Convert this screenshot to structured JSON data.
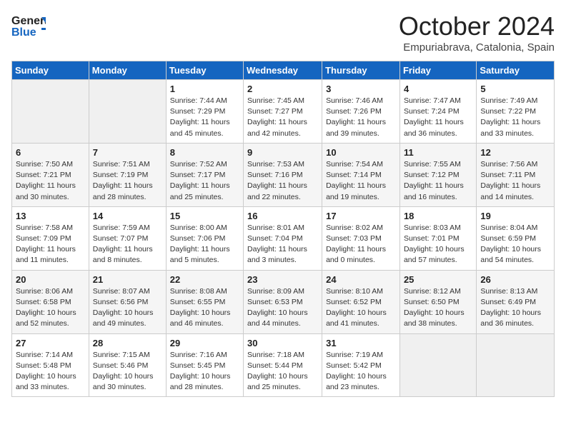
{
  "header": {
    "logo_general": "General",
    "logo_blue": "Blue",
    "month_title": "October 2024",
    "location": "Empuriabrava, Catalonia, Spain"
  },
  "days_of_week": [
    "Sunday",
    "Monday",
    "Tuesday",
    "Wednesday",
    "Thursday",
    "Friday",
    "Saturday"
  ],
  "weeks": [
    [
      {
        "day": "",
        "empty": true
      },
      {
        "day": "",
        "empty": true
      },
      {
        "day": "1",
        "sunrise": "7:44 AM",
        "sunset": "7:29 PM",
        "daylight": "11 hours and 45 minutes."
      },
      {
        "day": "2",
        "sunrise": "7:45 AM",
        "sunset": "7:27 PM",
        "daylight": "11 hours and 42 minutes."
      },
      {
        "day": "3",
        "sunrise": "7:46 AM",
        "sunset": "7:26 PM",
        "daylight": "11 hours and 39 minutes."
      },
      {
        "day": "4",
        "sunrise": "7:47 AM",
        "sunset": "7:24 PM",
        "daylight": "11 hours and 36 minutes."
      },
      {
        "day": "5",
        "sunrise": "7:49 AM",
        "sunset": "7:22 PM",
        "daylight": "11 hours and 33 minutes."
      }
    ],
    [
      {
        "day": "6",
        "sunrise": "7:50 AM",
        "sunset": "7:21 PM",
        "daylight": "11 hours and 30 minutes."
      },
      {
        "day": "7",
        "sunrise": "7:51 AM",
        "sunset": "7:19 PM",
        "daylight": "11 hours and 28 minutes."
      },
      {
        "day": "8",
        "sunrise": "7:52 AM",
        "sunset": "7:17 PM",
        "daylight": "11 hours and 25 minutes."
      },
      {
        "day": "9",
        "sunrise": "7:53 AM",
        "sunset": "7:16 PM",
        "daylight": "11 hours and 22 minutes."
      },
      {
        "day": "10",
        "sunrise": "7:54 AM",
        "sunset": "7:14 PM",
        "daylight": "11 hours and 19 minutes."
      },
      {
        "day": "11",
        "sunrise": "7:55 AM",
        "sunset": "7:12 PM",
        "daylight": "11 hours and 16 minutes."
      },
      {
        "day": "12",
        "sunrise": "7:56 AM",
        "sunset": "7:11 PM",
        "daylight": "11 hours and 14 minutes."
      }
    ],
    [
      {
        "day": "13",
        "sunrise": "7:58 AM",
        "sunset": "7:09 PM",
        "daylight": "11 hours and 11 minutes."
      },
      {
        "day": "14",
        "sunrise": "7:59 AM",
        "sunset": "7:07 PM",
        "daylight": "11 hours and 8 minutes."
      },
      {
        "day": "15",
        "sunrise": "8:00 AM",
        "sunset": "7:06 PM",
        "daylight": "11 hours and 5 minutes."
      },
      {
        "day": "16",
        "sunrise": "8:01 AM",
        "sunset": "7:04 PM",
        "daylight": "11 hours and 3 minutes."
      },
      {
        "day": "17",
        "sunrise": "8:02 AM",
        "sunset": "7:03 PM",
        "daylight": "11 hours and 0 minutes."
      },
      {
        "day": "18",
        "sunrise": "8:03 AM",
        "sunset": "7:01 PM",
        "daylight": "10 hours and 57 minutes."
      },
      {
        "day": "19",
        "sunrise": "8:04 AM",
        "sunset": "6:59 PM",
        "daylight": "10 hours and 54 minutes."
      }
    ],
    [
      {
        "day": "20",
        "sunrise": "8:06 AM",
        "sunset": "6:58 PM",
        "daylight": "10 hours and 52 minutes."
      },
      {
        "day": "21",
        "sunrise": "8:07 AM",
        "sunset": "6:56 PM",
        "daylight": "10 hours and 49 minutes."
      },
      {
        "day": "22",
        "sunrise": "8:08 AM",
        "sunset": "6:55 PM",
        "daylight": "10 hours and 46 minutes."
      },
      {
        "day": "23",
        "sunrise": "8:09 AM",
        "sunset": "6:53 PM",
        "daylight": "10 hours and 44 minutes."
      },
      {
        "day": "24",
        "sunrise": "8:10 AM",
        "sunset": "6:52 PM",
        "daylight": "10 hours and 41 minutes."
      },
      {
        "day": "25",
        "sunrise": "8:12 AM",
        "sunset": "6:50 PM",
        "daylight": "10 hours and 38 minutes."
      },
      {
        "day": "26",
        "sunrise": "8:13 AM",
        "sunset": "6:49 PM",
        "daylight": "10 hours and 36 minutes."
      }
    ],
    [
      {
        "day": "27",
        "sunrise": "7:14 AM",
        "sunset": "5:48 PM",
        "daylight": "10 hours and 33 minutes."
      },
      {
        "day": "28",
        "sunrise": "7:15 AM",
        "sunset": "5:46 PM",
        "daylight": "10 hours and 30 minutes."
      },
      {
        "day": "29",
        "sunrise": "7:16 AM",
        "sunset": "5:45 PM",
        "daylight": "10 hours and 28 minutes."
      },
      {
        "day": "30",
        "sunrise": "7:18 AM",
        "sunset": "5:44 PM",
        "daylight": "10 hours and 25 minutes."
      },
      {
        "day": "31",
        "sunrise": "7:19 AM",
        "sunset": "5:42 PM",
        "daylight": "10 hours and 23 minutes."
      },
      {
        "day": "",
        "empty": true
      },
      {
        "day": "",
        "empty": true
      }
    ]
  ]
}
